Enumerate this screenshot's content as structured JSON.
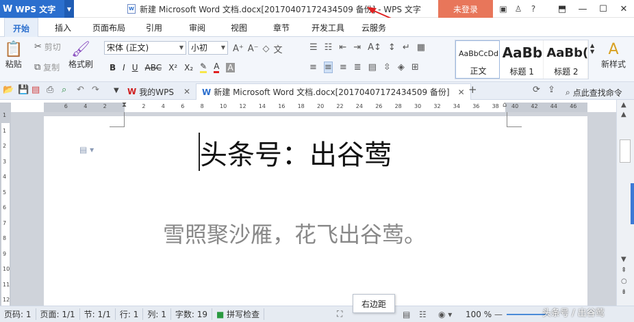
{
  "titlebar": {
    "app_name": "WPS 文字",
    "document_title": "新建 Microsoft Word 文档.docx[20170407172434509 备份] - WPS 文字",
    "login_label": "未登录",
    "help_label": "?"
  },
  "menu_tabs": [
    "开始",
    "插入",
    "页面布局",
    "引用",
    "审阅",
    "视图",
    "章节",
    "开发工具",
    "云服务"
  ],
  "ribbon": {
    "paste": "粘贴",
    "cut": "剪切",
    "copy": "复制",
    "format_painter": "格式刷",
    "font_name": "宋体 (正文)",
    "font_size": "小初",
    "styles": [
      {
        "preview": "AaBbCcDd",
        "label": "正文"
      },
      {
        "preview": "AaBb",
        "label": "标题 1"
      },
      {
        "preview": "AaBb(",
        "label": "标题 2"
      }
    ],
    "new_style": "新样式"
  },
  "doc_tabs": {
    "home_tab": "我的WPS",
    "doc_tab": "新建 Microsoft Word 文档.docx[20170407172434509 备份]",
    "search_label": "点此查找命令"
  },
  "ruler": {
    "h_numbers": [
      "6",
      "4",
      "2",
      "2",
      "4",
      "6",
      "8",
      "10",
      "12",
      "14",
      "16",
      "18",
      "20",
      "22",
      "24",
      "26",
      "28",
      "30",
      "32",
      "34",
      "36",
      "38",
      "40",
      "42",
      "44",
      "46"
    ],
    "v_numbers": [
      "1",
      "1",
      "2",
      "3",
      "4",
      "5",
      "6",
      "7",
      "8",
      "9",
      "10",
      "11",
      "12"
    ]
  },
  "document": {
    "heading": "头条号：出谷莺",
    "paragraph": "雪照聚沙雁，花飞出谷莺。"
  },
  "status": {
    "page_code": "页码: 1",
    "page": "页面: 1/1",
    "section": "节: 1/1",
    "line": "行: 1",
    "column": "列: 1",
    "word_count": "字数: 19",
    "spell_check": "拼写检查",
    "zoom": "100 %",
    "tooltip": "右边距",
    "watermark": "头条号 / 出谷莺"
  },
  "colors": {
    "accent": "#2b6fce",
    "login_bg": "#e8765a",
    "arrow": "#e02020"
  }
}
